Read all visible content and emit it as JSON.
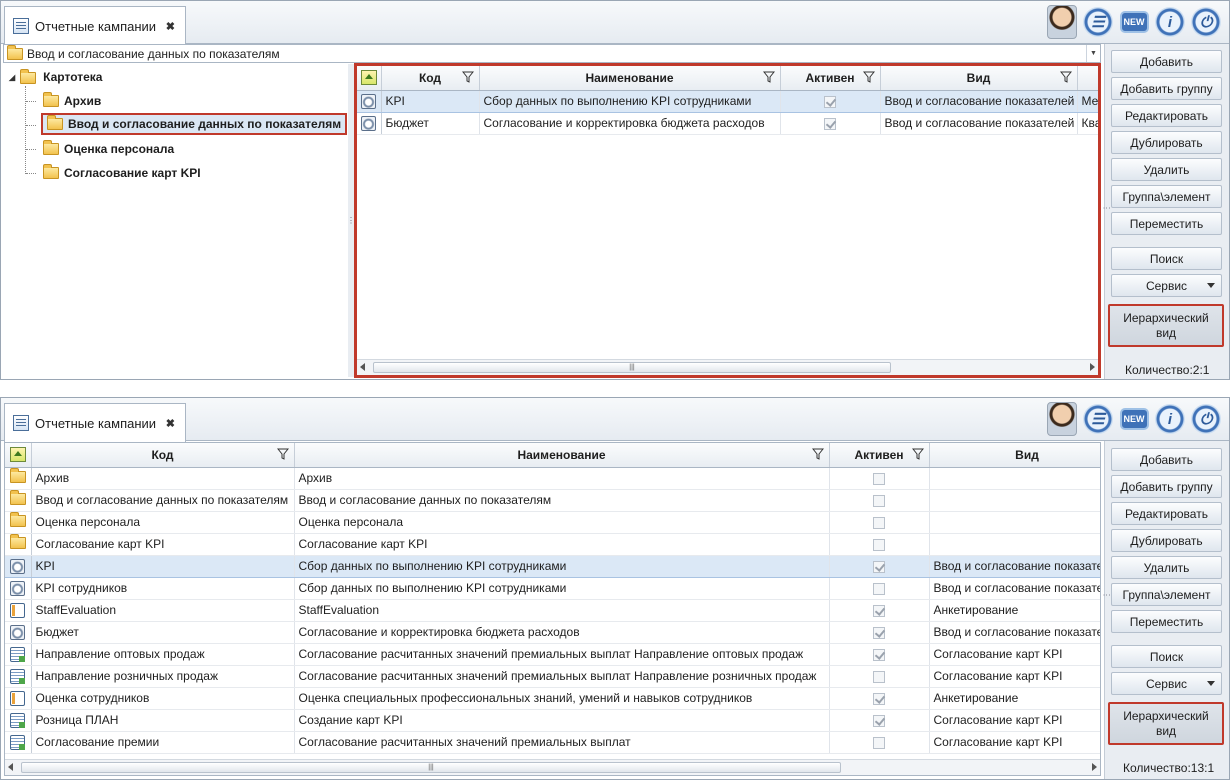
{
  "top": {
    "tab_title": "Отчетные кампании",
    "path": "Ввод и согласование данных по показателям",
    "tree": {
      "root": "Картотека",
      "items": [
        "Архив",
        "Ввод и согласование данных по показателям",
        "Оценка персонала",
        "Согласование карт KPI"
      ],
      "selected_index": 1
    },
    "columns": [
      "Код",
      "Наименование",
      "Активен",
      "Вид"
    ],
    "rows": [
      {
        "icon": "kpi-icon",
        "code": "KPI",
        "name": "Сбор данных по выполнению KPI сотрудниками",
        "active": true,
        "kind": "Ввод и согласование показателей",
        "extra": "Ме",
        "selected": true
      },
      {
        "icon": "kpi-icon",
        "code": "Бюджет",
        "name": "Согласование и корректировка бюджета расходов",
        "active": true,
        "kind": "Ввод и согласование показателей",
        "extra": "Ква",
        "selected": false
      }
    ],
    "count": "Количество:2:1"
  },
  "bottom": {
    "tab_title": "Отчетные кампании",
    "columns": [
      "Код",
      "Наименование",
      "Активен",
      "Вид"
    ],
    "rows": [
      {
        "icon": "folder-icon",
        "code": "Архив",
        "name": "Архив",
        "active": false,
        "kind": "",
        "selected": false
      },
      {
        "icon": "folder-icon",
        "code": "Ввод и согласование данных по показателям",
        "name": "Ввод и согласование данных по показателям",
        "active": false,
        "kind": "",
        "selected": false
      },
      {
        "icon": "folder-icon",
        "code": "Оценка персонала",
        "name": "Оценка персонала",
        "active": false,
        "kind": "",
        "selected": false
      },
      {
        "icon": "folder-icon",
        "code": "Согласование карт KPI",
        "name": "Согласование карт KPI",
        "active": false,
        "kind": "",
        "selected": false
      },
      {
        "icon": "kpi-icon",
        "code": "KPI",
        "name": "Сбор данных по выполнению KPI сотрудниками",
        "active": true,
        "kind": "Ввод и согласование показателей",
        "selected": true
      },
      {
        "icon": "kpi-icon",
        "code": "KPI сотрудников",
        "name": "Сбор данных по выполнению KPI сотрудниками",
        "active": false,
        "kind": "Ввод и согласование показателей",
        "selected": false
      },
      {
        "icon": "form-icon",
        "code": "StaffEvaluation",
        "name": "StaffEvaluation",
        "active": true,
        "kind": "Анкетирование",
        "selected": false
      },
      {
        "icon": "kpi-icon",
        "code": "Бюджет",
        "name": "Согласование и корректировка бюджета расходов",
        "active": true,
        "kind": "Ввод и согласование показателей",
        "selected": false
      },
      {
        "icon": "sheet-icon",
        "code": "Направление оптовых продаж",
        "name": "Согласование расчитанных значений премиальных выплат Направление оптовых продаж",
        "active": true,
        "kind": "Согласование карт KPI",
        "selected": false
      },
      {
        "icon": "sheet-icon",
        "code": "Направление розничных продаж",
        "name": "Согласование расчитанных значений премиальных выплат Направление розничных продаж",
        "active": false,
        "kind": "Согласование карт KPI",
        "selected": false
      },
      {
        "icon": "form-icon",
        "code": "Оценка сотрудников",
        "name": "Оценка специальных профессиональных знаний, умений и навыков сотрудников",
        "active": true,
        "kind": "Анкетирование",
        "selected": false
      },
      {
        "icon": "sheet-icon",
        "code": "Розница ПЛАН",
        "name": "Создание карт KPI",
        "active": true,
        "kind": "Согласование карт KPI",
        "selected": false
      },
      {
        "icon": "sheet-icon",
        "code": "Согласование премии",
        "name": "Согласование расчитанных значений премиальных выплат",
        "active": false,
        "kind": "Согласование карт KPI",
        "selected": false
      }
    ],
    "count": "Количество:13:1"
  },
  "buttons": {
    "add": "Добавить",
    "add_group": "Добавить группу",
    "edit": "Редактировать",
    "duplicate": "Дублировать",
    "delete": "Удалить",
    "group_element": "Группа\\элемент",
    "move": "Переместить",
    "search": "Поиск",
    "service": "Сервис",
    "hier_line1": "Иерархический",
    "hier_line2": "вид"
  },
  "toolbar_icons": [
    "user-avatar-icon",
    "report-icon",
    "new-icon",
    "info-icon",
    "power-icon"
  ],
  "colors": {
    "highlight_border": "#c0392b",
    "selected_row": "#dbe8f6"
  }
}
